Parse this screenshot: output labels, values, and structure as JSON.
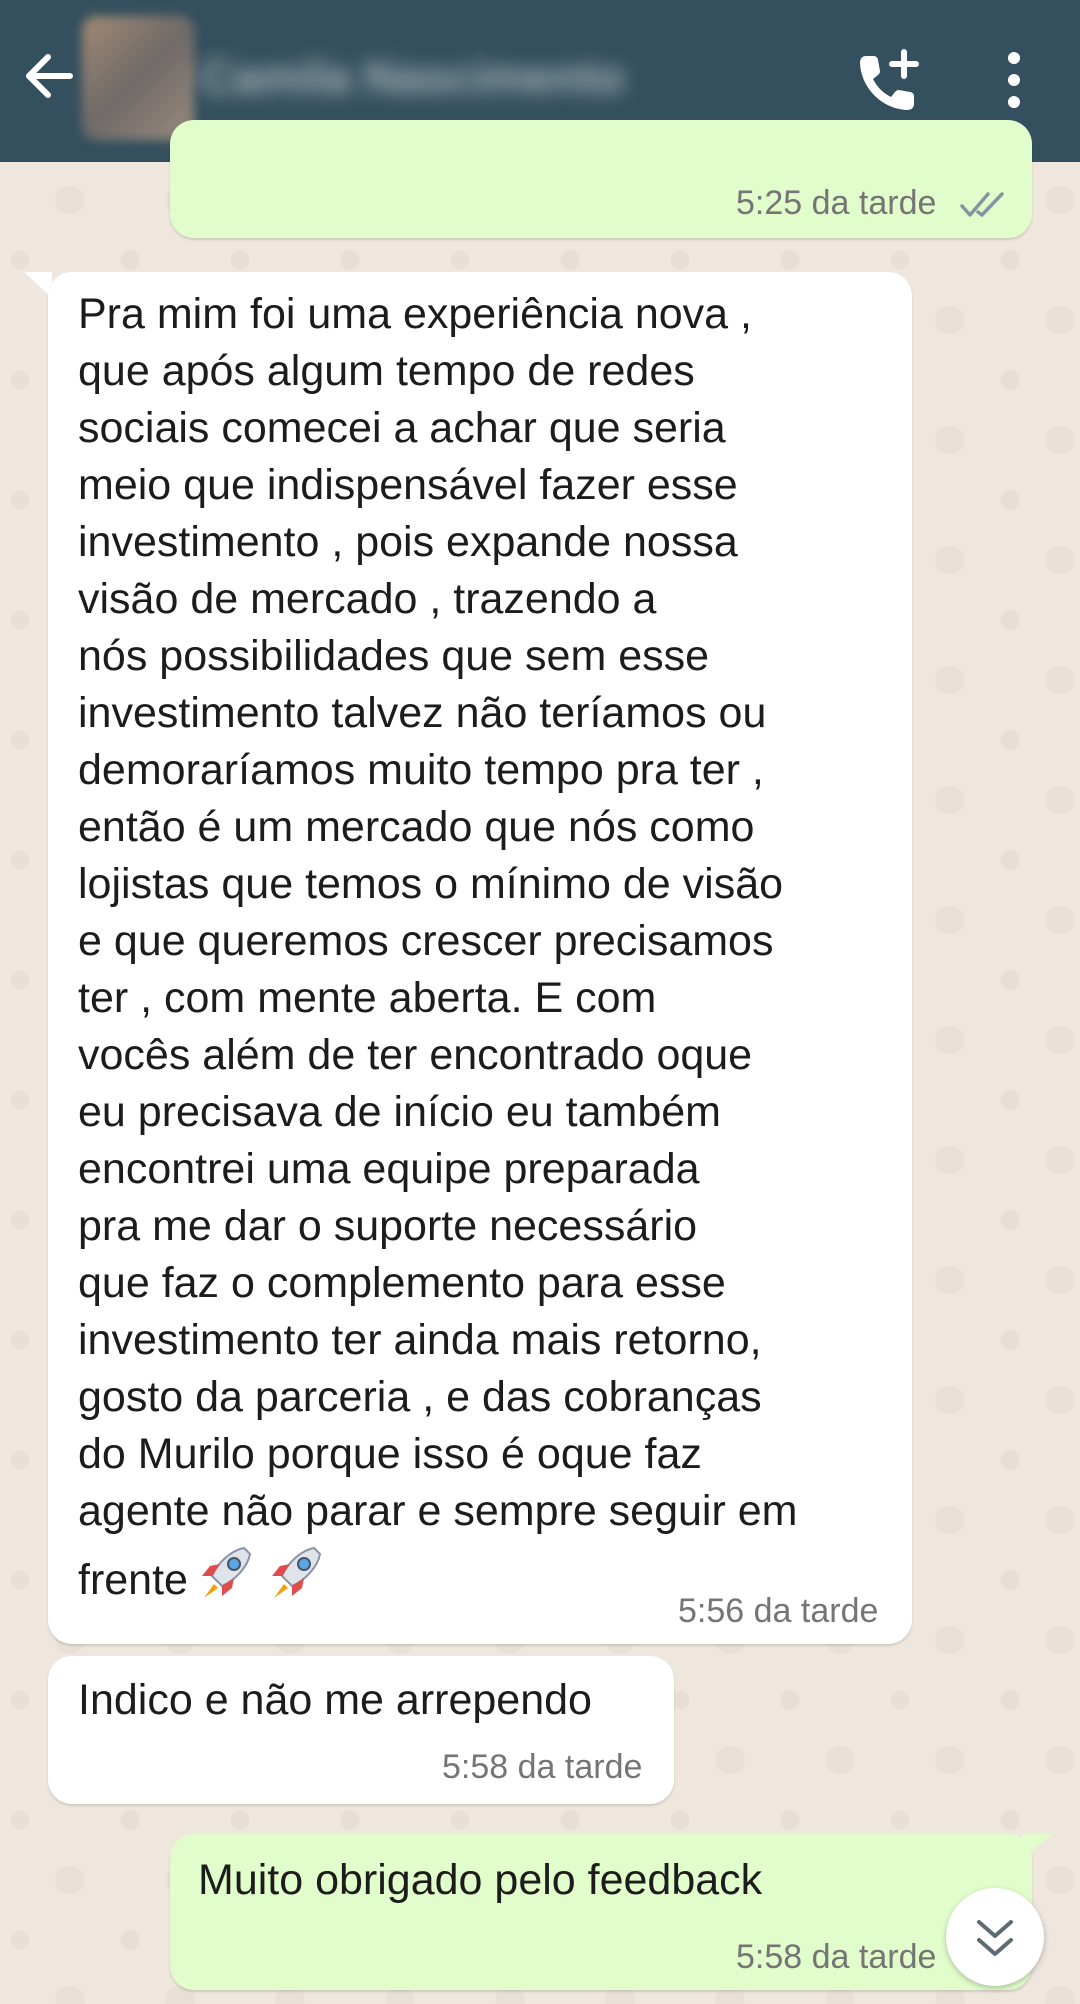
{
  "header": {
    "contact_name": "Camila Nascimento"
  },
  "messages": [
    {
      "direction": "outgoing",
      "text": "",
      "time": "5:25 da tarde",
      "status": "read"
    },
    {
      "direction": "incoming",
      "text": "Pra mim foi uma experiência nova ,\nque após algum tempo de redes\nsociais comecei a achar que seria\nmeio que indispensável fazer esse\ninvestimento , pois expande nossa\nvisão de mercado , trazendo a\nnós possibilidades que sem esse\ninvestimento talvez não teríamos ou\ndemoraríamos muito tempo pra ter ,\nentão é um mercado que nós como\nlojistas que temos o mínimo de visão\ne que queremos crescer precisamos\nter , com mente aberta. E com\nvocês além de ter encontrado oque\neu precisava de início eu também\nencontrei uma equipe preparada\npra me dar o suporte necessário\nque faz o complemento para esse\ninvestimento ter ainda mais retorno,\ngosto da parceria , e das cobranças\ndo Murilo porque isso é oque faz\nagente não parar e sempre seguir em\nfrente",
      "emoji": "rocket-rocket",
      "time": "5:56 da tarde"
    },
    {
      "direction": "incoming",
      "text": "Indico e não me arrependo",
      "time": "5:58 da tarde"
    },
    {
      "direction": "outgoing",
      "text": "Muito obrigado pelo feedback",
      "time": "5:58 da tarde",
      "status": "read"
    }
  ],
  "colors": {
    "header_bg": "#34505e",
    "outgoing_bubble": "#e2fdcc",
    "incoming_bubble": "#ffffff",
    "read_ticks": "#8696a0"
  },
  "icons": [
    "back-arrow-icon",
    "add-call-icon",
    "more-options-icon",
    "double-check-icon",
    "rocket-emoji-icon",
    "scroll-down-icon"
  ]
}
